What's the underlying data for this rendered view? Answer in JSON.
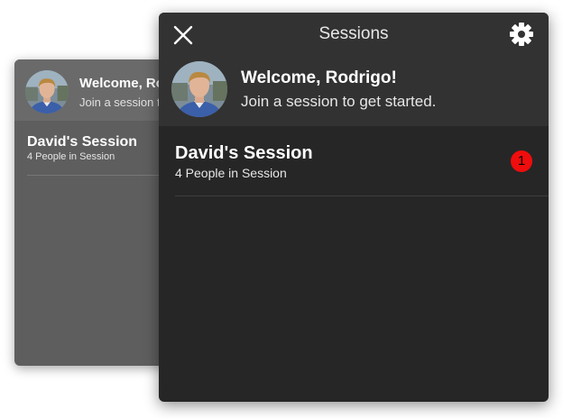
{
  "back_panel": {
    "welcome": "Welcome, Rodrigo!",
    "subtitle": "Join a session to get started.",
    "session": {
      "title": "David's Session",
      "subtitle": "4 People in Session"
    }
  },
  "front_panel": {
    "nav_title": "Sessions",
    "welcome": "Welcome, Rodrigo!",
    "subtitle": "Join a session to get started.",
    "session": {
      "title": "David's Session",
      "subtitle": "4 People in Session",
      "badge_count": "1"
    }
  },
  "icons": {
    "close": "close-icon",
    "settings": "gear-icon",
    "avatar": "user-avatar"
  },
  "colors": {
    "panel_background": "#262626",
    "header_background": "#323232",
    "badge": "#f00d0d",
    "back_panel": "#5e5e5e"
  }
}
